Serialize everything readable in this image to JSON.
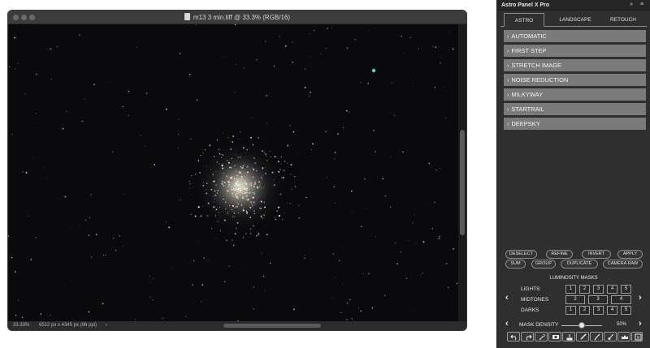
{
  "document": {
    "title": "m13 3 min.tiff @ 33.3% (RGB/16)",
    "zoom": "33.33%",
    "info": "6512 px x 4345 px (96 ppi)",
    "nav_arrow": "›"
  },
  "panel": {
    "title": "Astro Panel X Pro",
    "collapse_icon": "»",
    "menu_icon": "≡",
    "tabs": [
      "ASTRO",
      "LANDSCAPE",
      "RETOUCH"
    ],
    "active_tab": "ASTRO",
    "sections": [
      "AUTOMATIC",
      "FIRST STEP",
      "STRETCH IMAGE",
      "NOISE REDUCTION",
      "MILKYWAY",
      "STARTRAIL",
      "DEEPSKY"
    ],
    "section_chevron": "›",
    "row1_buttons": [
      "DESELECT",
      "REFINE",
      "INVERT",
      "APPLY"
    ],
    "row2_buttons": [
      "SUM",
      "GROUP",
      "DUPLICATE",
      "CAMERA RAW"
    ],
    "luminosity": {
      "title": "LUMINOSITY MASKS",
      "lights_label": "LIGHTS",
      "lights": [
        "1",
        "2",
        "3",
        "4",
        "5"
      ],
      "midtones_label": "MIDTONES",
      "midtones": [
        "2",
        "3",
        "4"
      ],
      "darks_label": "DARKS",
      "darks": [
        "1",
        "2",
        "3",
        "4",
        "5"
      ],
      "prev_arrow": "‹",
      "next_arrow": "›"
    },
    "density": {
      "label": "MASK DENSITY",
      "value": "50%",
      "level": 0.5,
      "prev_arrow": "‹",
      "next_arrow": "›"
    },
    "toolbar_icons": [
      "undo-icon",
      "redo-icon",
      "magic-wand-icon",
      "mask-icon",
      "stamp-icon",
      "brush-icon",
      "brush-small-icon",
      "brush-soft-icon",
      "crown-icon",
      "info-icon"
    ]
  },
  "colors": {
    "panel_bg": "#2f2f2f",
    "section_bg": "#7a7a7a",
    "canvas_bg": "#0a0a0c",
    "star_teal": "#4fe0b0"
  }
}
